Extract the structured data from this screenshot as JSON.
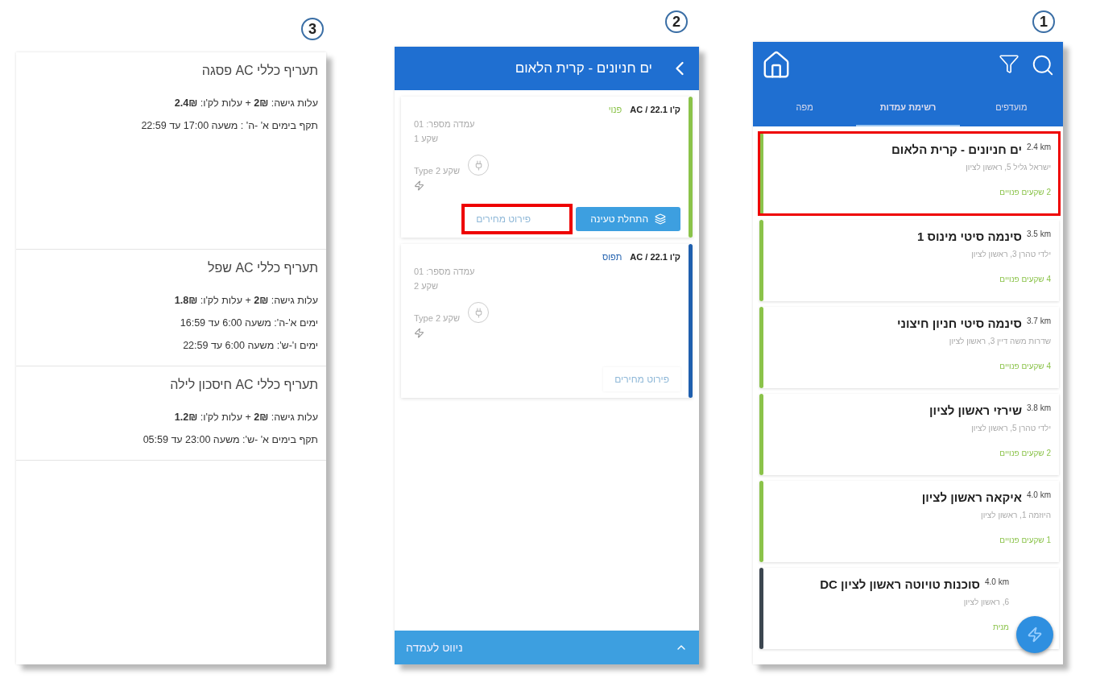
{
  "tariffs_screen": {
    "step": "3",
    "sections": [
      {
        "title": "תעריף כללי AC פסגה",
        "lines": [
          "עלות גישה: **2₪** + עלות לק'ו: **2.4₪**",
          "תקף בימים א' -ה' : משעה 17:00 עד 22:59"
        ]
      },
      {
        "title": "תעריף כללי AC שפל",
        "lines": [
          "עלות גישה: **2₪** + עלות לק'ו: **1.8₪**",
          "ימים א'-ה': משעה 6:00 עד 16:59",
          "ימים ו'-ש': משעה 6:00 עד 22:59"
        ]
      },
      {
        "title": "תעריף כללי AC חיסכון לילה",
        "lines": [
          "עלות גישה: **2₪** + עלות לק'ו: **1.2₪**",
          "תקף בימים א' -ש': משעה 23:00 עד 05:59"
        ]
      }
    ]
  },
  "station_screen": {
    "step": "2",
    "title": "ים חניונים - קרית הלאום",
    "connectors": [
      {
        "power": "ק'ו AC / 22.1",
        "status": "פנוי",
        "color": "#8bc34a",
        "station_number": "עמדה מספר: 01",
        "socket": "שקע 1",
        "socket_type": "שקע Type 2",
        "buttons": [
          {
            "kind": "primary",
            "label": "התחלת טעינה",
            "highlighted": false
          },
          {
            "kind": "text",
            "label": "פירוט מחירים",
            "highlighted": true
          }
        ]
      },
      {
        "power": "ק'ו AC / 22.1",
        "status": "תפוס",
        "color": "#1f5fae",
        "station_number": "עמדה מספר: 01",
        "socket": "שקע 2",
        "socket_type": "שקע Type 2",
        "buttons": [
          {
            "kind": "text",
            "label": "פירוט מחירים",
            "highlighted": false
          }
        ]
      }
    ],
    "bottom_bar": "ניווט לעמדה"
  },
  "list_screen": {
    "step": "1",
    "tabs": [
      {
        "label": "מועדפים",
        "selected": false
      },
      {
        "label": "רשימת עמדות",
        "selected": true
      },
      {
        "label": "מפה",
        "selected": false
      }
    ],
    "stations": [
      {
        "name": "ים חניונים - קרית הלאום",
        "distance": "2.4 km",
        "address": "ישראל גליל 5, ראשון לציון",
        "availability": "2 שקעים פנויים",
        "color": "#8bc34a",
        "highlighted": true,
        "partly_covered": false
      },
      {
        "name": "סינמה סיטי מינוס 1",
        "distance": "3.5 km",
        "address": "ילדי טהרן 3, ראשון לציון",
        "availability": "4 שקעים פנויים",
        "color": "#8bc34a",
        "highlighted": false,
        "partly_covered": false
      },
      {
        "name": "סינמה סיטי חניון חיצוני",
        "distance": "3.7 km",
        "address": "שדרות משה דיין 3, ראשון לציון",
        "availability": "4 שקעים פנויים",
        "color": "#8bc34a",
        "highlighted": false,
        "partly_covered": false
      },
      {
        "name": "שירזי ראשון לציון",
        "distance": "3.8 km",
        "address": "ילדי טהרן 5, ראשון לציון",
        "availability": "2 שקעים פנויים",
        "color": "#8bc34a",
        "highlighted": false,
        "partly_covered": false
      },
      {
        "name": "איקאה ראשון לציון",
        "distance": "4.0 km",
        "address": "היוזמה 1, ראשון לציון",
        "availability": "1 שקעים פנויים",
        "color": "#8bc34a",
        "highlighted": false,
        "partly_covered": false
      },
      {
        "name": "סוכנות טויוטה ראשון לציון DC",
        "distance": "4.0 km",
        "address": "6, ראשון לציון",
        "availability": "מנית",
        "color": "#3c4650",
        "highlighted": false,
        "partly_covered": true
      }
    ]
  }
}
